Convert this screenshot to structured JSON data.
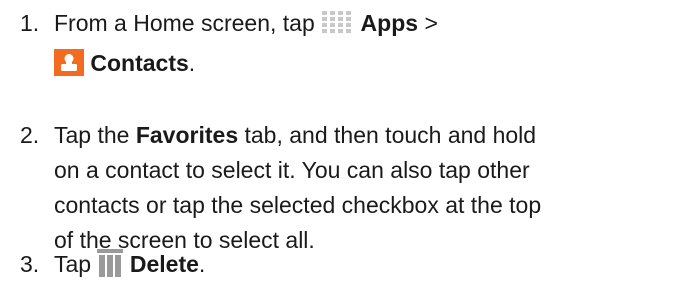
{
  "steps": [
    {
      "number": "1.",
      "pre": "From a Home screen, tap",
      "apps_label": "Apps",
      "separator": ">",
      "contacts_label": "Contacts",
      "end": ".",
      "apps_icon": "apps-grid-icon",
      "contacts_icon": "contacts-icon"
    },
    {
      "number": "2.",
      "pre": "Tap the",
      "favorites_label": "Favorites",
      "line1_post": "tab, and then touch and hold",
      "line2": "on a contact to select it. You can also tap other",
      "line3": "contacts or tap the selected checkbox at the top",
      "line4": "of the screen to select all."
    },
    {
      "number": "3.",
      "pre": "Tap",
      "delete_label": "Delete",
      "end": ".",
      "delete_icon": "trash-icon"
    }
  ],
  "colors": {
    "text": "#1a1a1a",
    "contacts_icon_bg": "#f26b21",
    "apps_icon_dots": "#c8c8c8",
    "trash_icon": "#9a9a9a"
  }
}
